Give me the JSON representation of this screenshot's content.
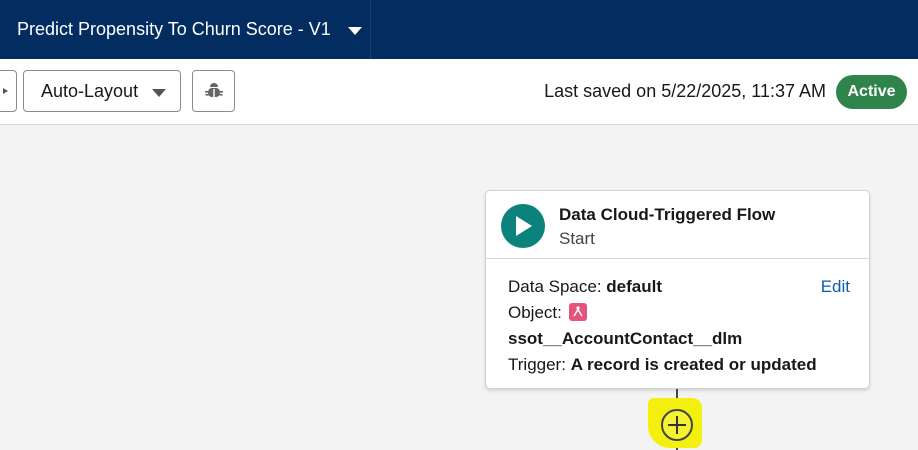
{
  "header": {
    "flow_title": "Predict Propensity To Churn Score - V1",
    "title_menu_icon": "chevron-down-icon"
  },
  "toolbar": {
    "layout_label": "Auto-Layout",
    "layout_icon": "chevron-down-icon",
    "debug_icon": "bug-icon",
    "last_saved": "Last saved on 5/22/2025, 11:37 AM",
    "status": "Active",
    "status_color": "#2e844a"
  },
  "start_card": {
    "title": "Data Cloud-Triggered Flow",
    "subtitle": "Start",
    "data_space_label": "Data Space:",
    "data_space_value": "default",
    "edit_label": "Edit",
    "object_label": "Object:",
    "object_value": "ssot__AccountContact__dlm",
    "trigger_label": "Trigger:",
    "trigger_value": "A record is created or updated",
    "icon_color": "#0b827c"
  },
  "add_element_icon": "plus-icon"
}
